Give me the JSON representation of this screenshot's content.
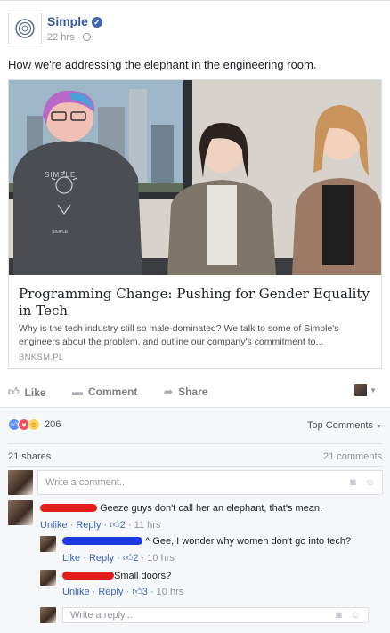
{
  "post": {
    "page_name": "Simple",
    "time": "22 hrs",
    "text": "How we're addressing the elephant in the engineering room."
  },
  "link": {
    "title": "Programming Change: Pushing for Gender Equality in Tech",
    "description": "Why is the tech industry still so male-dominated? We talk to some of Simple's engineers about the problem, and outline our company's commitment to...",
    "domain": "BNKSM.PL",
    "shirt_text": "SIMPLE"
  },
  "actions": {
    "like": "Like",
    "comment": "Comment",
    "share": "Share"
  },
  "stats": {
    "reactions_count": "206",
    "sort_label": "Top Comments",
    "shares": "21 shares",
    "comments": "21 comments"
  },
  "composer": {
    "comment_placeholder": "Write a comment...",
    "reply_placeholder": "Write a reply..."
  },
  "comments": [
    {
      "text": "Geeze guys don't call her an elephant, that's mean.",
      "unlike": "Unlike",
      "reply": "Reply",
      "likes": "2",
      "time": "11 hrs"
    }
  ],
  "replies": [
    {
      "text": "^ Gee, I wonder why women don't go into tech?",
      "like": "Like",
      "reply": "Reply",
      "likes": "2",
      "time": "10 hrs"
    },
    {
      "text": "Small doors?",
      "unlike": "Unlike",
      "reply": "Reply",
      "likes": "3",
      "time": "10 hrs"
    }
  ],
  "colors": {
    "link_blue": "#365899",
    "accent": "#4267b2",
    "redaction_red": "#e31c1c",
    "redaction_blue": "#1d39e0"
  }
}
